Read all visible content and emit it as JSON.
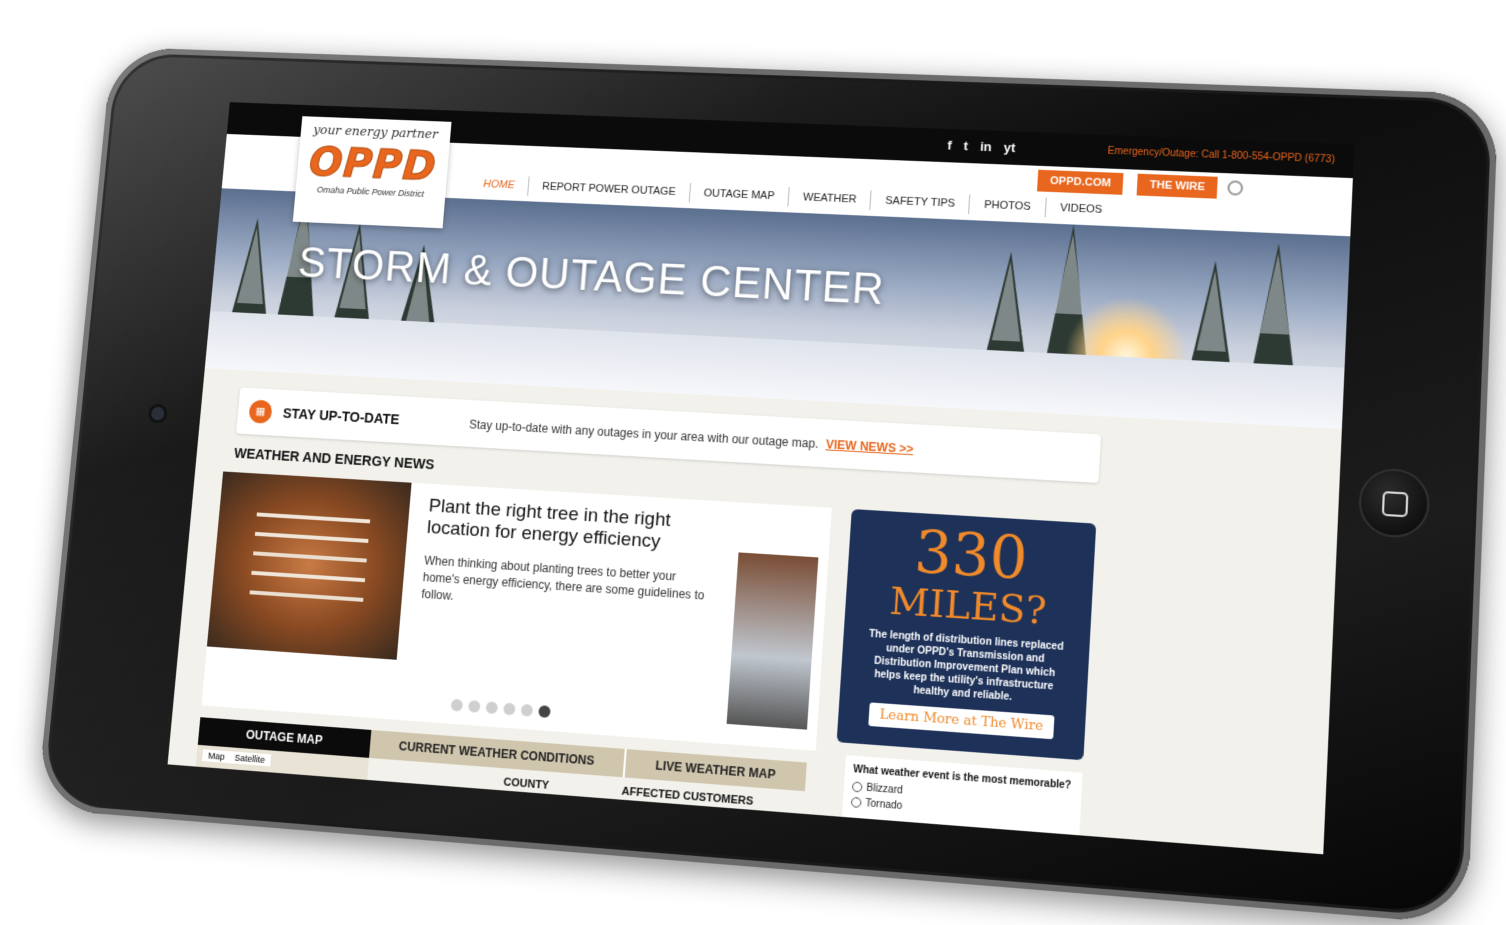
{
  "topbar": {
    "social": [
      "f",
      "t",
      "in",
      "yt"
    ],
    "emergency": "Emergency/Outage: Call 1-800-554-OPPD (6773)"
  },
  "logo": {
    "tagline": "your energy partner",
    "wordmark": "OPPD",
    "name": "Omaha Public Power District"
  },
  "header": {
    "buttons": [
      "OPPD.COM",
      "THE WIRE"
    ]
  },
  "nav": {
    "items": [
      "HOME",
      "REPORT POWER OUTAGE",
      "OUTAGE MAP",
      "WEATHER",
      "SAFETY TIPS",
      "PHOTOS",
      "VIDEOS"
    ]
  },
  "hero": {
    "title": "STORM & OUTAGE CENTER"
  },
  "stay": {
    "title": "STAY UP-TO-DATE",
    "text": "Stay up-to-date with any outages in your area with our outage map.",
    "link": "VIEW NEWS >>"
  },
  "news": {
    "heading": "WEATHER AND ENERGY NEWS",
    "title": "Plant the right tree in the right location for energy efficiency",
    "body": "When thinking about planting trees to better your home's energy efficiency, there are some guidelines to follow.",
    "slides": 6,
    "active_slide": 6
  },
  "promo": {
    "number": "330",
    "unit": "MILES?",
    "text": "The length of distribution lines replaced under OPPD's Transmission and Distribution Improvement Plan which helps keep the utility's infrastructure healthy and reliable.",
    "button": "Learn More at The Wire"
  },
  "tabs": {
    "outage_map": "OUTAGE MAP",
    "current_weather": "CURRENT WEATHER CONDITIONS",
    "live_weather": "LIVE WEATHER MAP"
  },
  "map": {
    "tab_map": "Map",
    "tab_satellite": "Satellite"
  },
  "table": {
    "county": "COUNTY",
    "affected": "AFFECTED CUSTOMERS"
  },
  "poll": {
    "question": "What weather event is the most memorable?",
    "options": [
      "Blizzard",
      "Tornado"
    ]
  }
}
